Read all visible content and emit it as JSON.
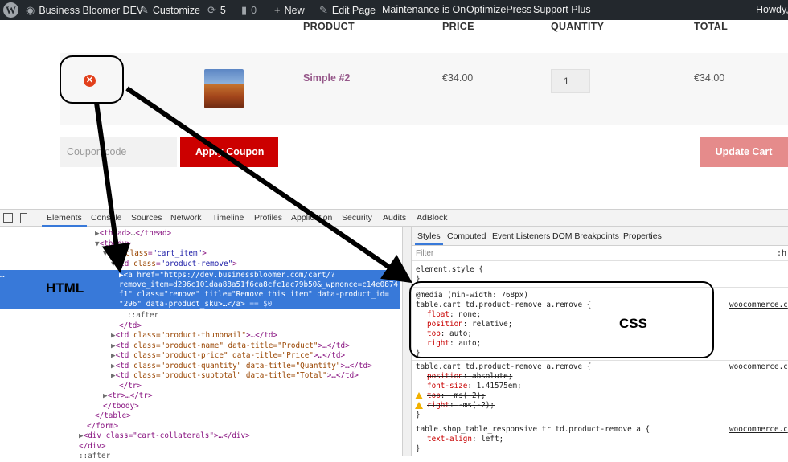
{
  "adminbar": {
    "site_name": "Business Bloomer DEV",
    "customize": "Customize",
    "updates_count": "5",
    "comments_count": "0",
    "new": "New",
    "edit_page": "Edit Page",
    "maintenance": "Maintenance is On",
    "optimizepress": "OptimizePress",
    "support_plus": "Support Plus",
    "howdy": "Howdy,"
  },
  "cart": {
    "headers": {
      "product": "PRODUCT",
      "price": "PRICE",
      "quantity": "QUANTITY",
      "total": "TOTAL"
    },
    "item": {
      "name": "Simple #2",
      "price": "€34.00",
      "quantity": "1",
      "total": "€34.00"
    },
    "coupon_placeholder": "Coupon code",
    "apply_label": "Apply Coupon",
    "update_label": "Update Cart"
  },
  "devtools": {
    "tabs": [
      "Elements",
      "Console",
      "Sources",
      "Network",
      "Timeline",
      "Profiles",
      "Application",
      "Security",
      "Audits",
      "AdBlock"
    ],
    "active_tab": "Elements",
    "dom": {
      "l1_a": "<thead>",
      "l1_b": "…",
      "l1_c": "</thead>",
      "l2": "<tbody>",
      "l3_a": "<tr ",
      "l3_an": "class",
      "l3_av": "\"cart_item\"",
      "l3_c": ">",
      "l4_a": "<td ",
      "l4_an": "class",
      "l4_av": "\"product-remove\"",
      "l4_c": ">",
      "s1_a": "<a ",
      "s1_an": "href",
      "s1_av": "\"https://dev.businessbloomer.com/cart/?",
      "s2": "remove_item=d296c101daa88a51f6ca8cfc1ac79b50&_wpnonce=c14e0874",
      "s3_a": "f1\" ",
      "s3_an": "class",
      "s3_av": "\"remove\" ",
      "s3_bn": "title",
      "s3_bv": "\"Remove this item\" ",
      "s3_cn": "data-product_id=",
      "s4_a": "\"296\" ",
      "s4_bn": "data-product_sku",
      "s4_c": ">…</a>",
      "s4_d": " == $0",
      "after": "::after",
      "td_close": "</td>",
      "rows": [
        {
          "open": "<td ",
          "attrs": "class=\"product-thumbnail\"",
          "rest": ">…</td>"
        },
        {
          "open": "<td ",
          "attrs": "class=\"product-name\" data-title=\"Product\"",
          "rest": ">…</td>"
        },
        {
          "open": "<td ",
          "attrs": "class=\"product-price\" data-title=\"Price\"",
          "rest": ">…</td>"
        },
        {
          "open": "<td ",
          "attrs": "class=\"product-quantity\" data-title=\"Quantity\"",
          "rest": ">…</td>"
        },
        {
          "open": "<td ",
          "attrs": "class=\"product-subtotal\" data-title=\"Total\"",
          "rest": ">…</td>"
        }
      ],
      "tr_close": "</tr>",
      "tr_collapsed": "<tr>…</tr>",
      "tbody_close": "</tbody>",
      "table_close": "</table>",
      "form_close": "</form>",
      "collaterals": "<div class=\"cart-collaterals\">…</div>",
      "div_close": "</div>",
      "after2": "::after"
    },
    "styles": {
      "tabs": [
        "Styles",
        "Computed",
        "Event Listeners",
        "DOM Breakpoints",
        "Properties"
      ],
      "filter_placeholder": "Filter",
      "filter_hov": ":h",
      "element_style": "element.style {",
      "close_brace": "}",
      "rule1": {
        "media": "@media (min-width: 768px)",
        "selector": "table.cart td.product-remove a.remove {",
        "source": "woocommerce.c",
        "props": [
          {
            "name": "float",
            "value": "none;"
          },
          {
            "name": "position",
            "value": "relative;"
          },
          {
            "name": "top",
            "value": "auto;"
          },
          {
            "name": "right",
            "value": "auto;"
          }
        ]
      },
      "rule2": {
        "selector": "table.cart td.product-remove a.remove {",
        "source": "woocommerce.c",
        "props": [
          {
            "name": "position",
            "value": "absolute;"
          },
          {
            "name": "font-size",
            "value": "1.41575em;"
          },
          {
            "name": "top",
            "value": "-ms(-2);"
          },
          {
            "name": "right",
            "value": "-ms(-2);"
          }
        ]
      },
      "rule3": {
        "selector": "table.shop_table_responsive tr td.product-remove a {",
        "source": "woocommerce.c",
        "props": [
          {
            "name": "text-align",
            "value": "left;"
          }
        ]
      }
    }
  },
  "annotations": {
    "html_label": "HTML",
    "css_label": "CSS"
  }
}
